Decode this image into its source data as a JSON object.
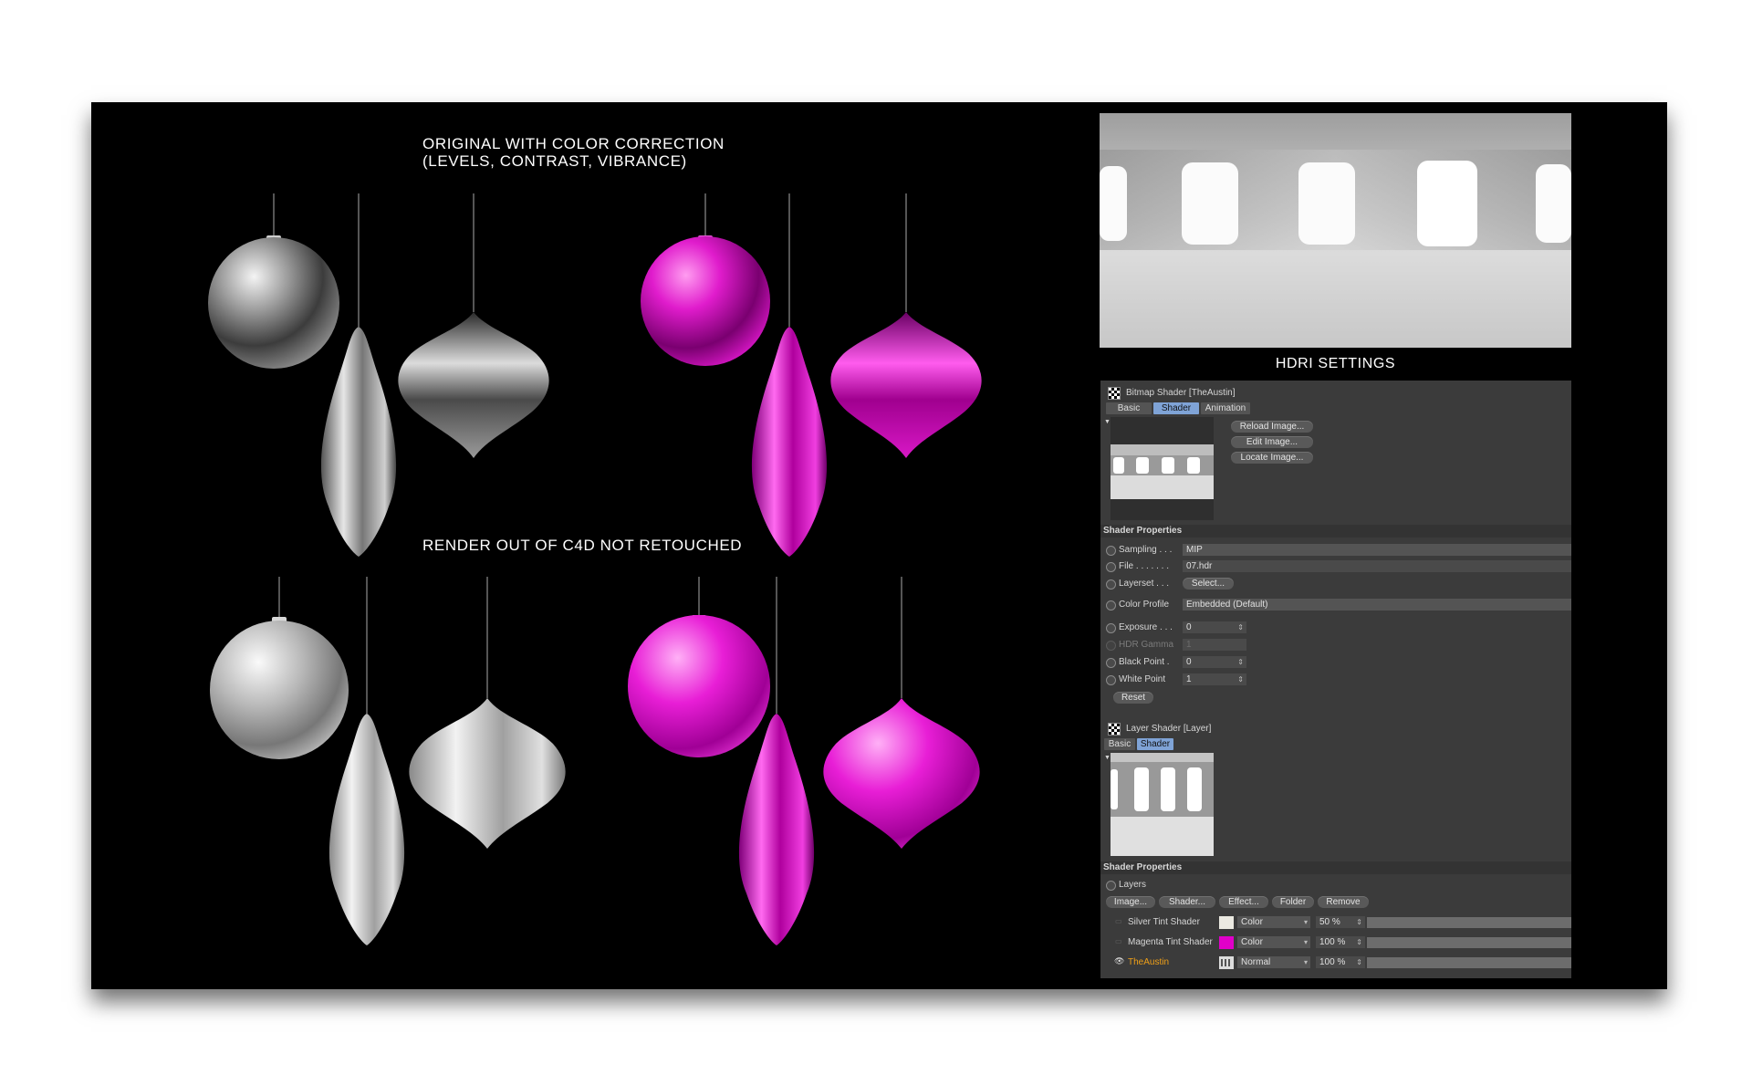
{
  "board": {
    "caption_top_line1": "ORIGINAL WITH COLOR CORRECTION",
    "caption_top_line2": "(LEVELS, CONTRAST, VIBRANCE)",
    "caption_bottom": "RENDER OUT OF C4D NOT RETOUCHED",
    "hdri_title": "HDRI SETTINGS"
  },
  "colors": {
    "silver": "#b8b8b8",
    "magenta": "#d21cc0",
    "panel_bg": "#3b3b3b",
    "tab_active": "#7fa3d6",
    "highlight_label": "#f0a018"
  },
  "bitmap_shader": {
    "title": "Bitmap Shader [TheAustin]",
    "tabs": [
      "Basic",
      "Shader",
      "Animation"
    ],
    "active_tab": "Shader",
    "buttons": [
      "Reload Image...",
      "Edit Image...",
      "Locate Image..."
    ],
    "section": "Shader Properties",
    "sampling_label": "Sampling . . .",
    "sampling_value": "MIP",
    "file_label": "File . . . . . . .",
    "file_value": "07.hdr",
    "layerset_label": "Layerset . . .",
    "layerset_button": "Select...",
    "color_profile_label": "Color Profile",
    "color_profile_value": "Embedded (Default)",
    "exposure_label": "Exposure . . .",
    "exposure_value": "0",
    "hdr_gamma_label": "HDR Gamma",
    "hdr_gamma_value": "1",
    "black_point_label": "Black Point .",
    "black_point_value": "0",
    "white_point_label": "White Point",
    "white_point_value": "1",
    "reset_button": "Reset"
  },
  "layer_shader": {
    "title": "Layer Shader [Layer]",
    "tabs": [
      "Basic",
      "Shader"
    ],
    "active_tab": "Shader",
    "section": "Shader Properties",
    "layers_label": "Layers",
    "buttons": [
      "Image...",
      "Shader...",
      "Effect...",
      "Folder",
      "Remove"
    ],
    "rows": [
      {
        "name": "Silver Tint Shader",
        "swatch": "#ebe9e1",
        "mode": "Color",
        "opacity": "50 %"
      },
      {
        "name": "Magenta Tint Shader",
        "swatch": "#e000c8",
        "mode": "Color",
        "opacity": "100 %"
      },
      {
        "name": "TheAustin",
        "swatch": "",
        "mode": "Normal",
        "opacity": "100 %"
      }
    ]
  }
}
